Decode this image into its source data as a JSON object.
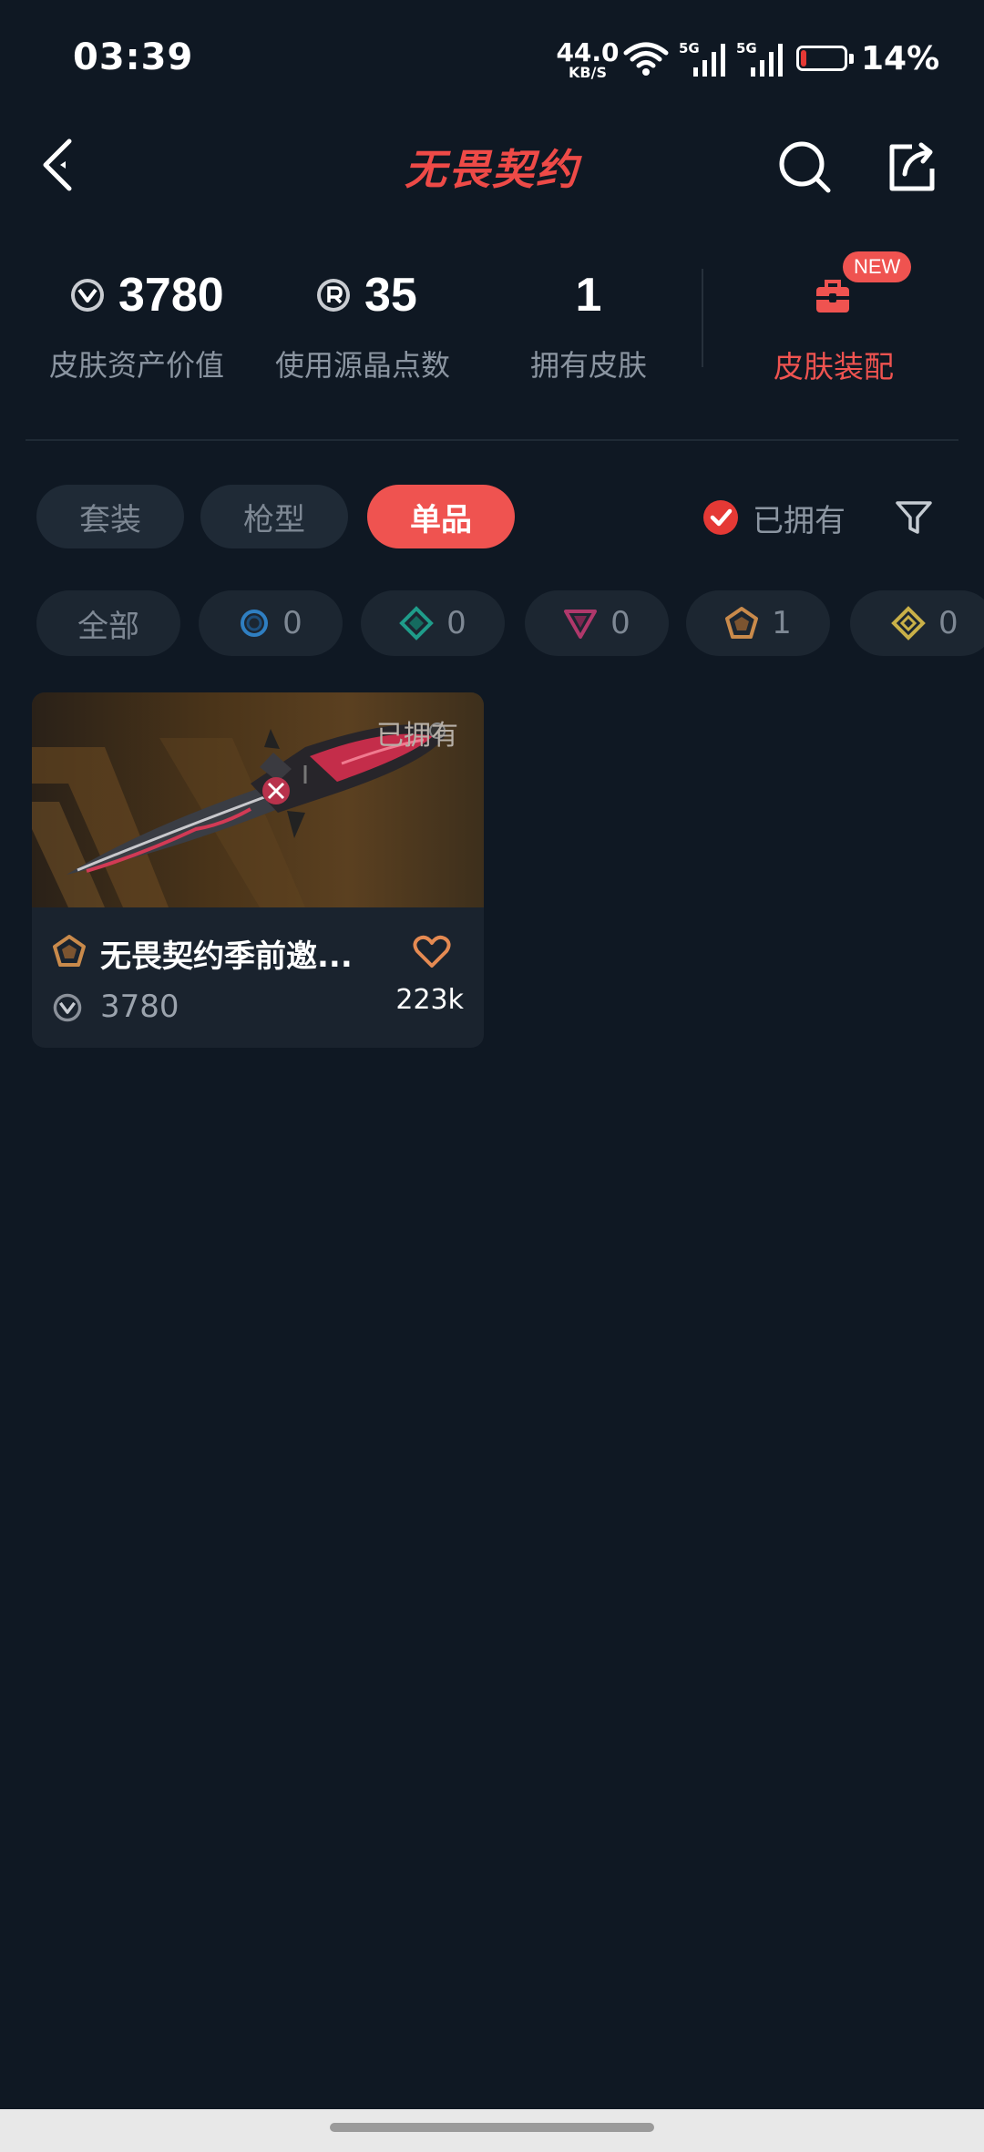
{
  "status_bar": {
    "time": "03:39",
    "net_speed_value": "44.0",
    "net_speed_unit": "KB/S",
    "signal1_label": "5G",
    "signal2_label": "5G",
    "battery_percent": "14%",
    "battery_level": 0.14,
    "battery_color": "#e53935"
  },
  "header": {
    "title": "无畏契约",
    "back_icon": "back-arrow-icon",
    "search_icon": "search-icon",
    "share_icon": "share-icon"
  },
  "stats": {
    "asset_value": "3780",
    "asset_value_label": "皮肤资产价值",
    "radianite_points": "35",
    "radianite_points_label": "使用源晶点数",
    "owned_skins": "1",
    "owned_skins_label": "拥有皮肤",
    "loadout_label": "皮肤装配",
    "new_badge": "NEW"
  },
  "tabs": [
    {
      "label": "套装",
      "active": false
    },
    {
      "label": "枪型",
      "active": false
    },
    {
      "label": "单品",
      "active": true
    }
  ],
  "filters": {
    "owned_label": "已拥有",
    "owned_checked": true,
    "filter_icon": "filter-icon"
  },
  "rarity_chips": [
    {
      "label": "全部"
    },
    {
      "icon": "select-tier-icon",
      "count": "0",
      "color": "#2f7fc2"
    },
    {
      "icon": "deluxe-tier-icon",
      "count": "0",
      "color": "#1f9c8a"
    },
    {
      "icon": "premium-tier-icon",
      "count": "0",
      "color": "#b0386b"
    },
    {
      "icon": "exclusive-tier-icon",
      "count": "1",
      "color": "#c98a4b"
    },
    {
      "icon": "ultra-tier-icon",
      "count": "0",
      "color": "#c9b048"
    }
  ],
  "skins": [
    {
      "owned_tag": "已拥有",
      "name": "无畏契约季前邀...",
      "price": "3780",
      "likes": "223k",
      "tier_icon": "exclusive-tier-icon"
    }
  ],
  "colors": {
    "accent": "#ef5350",
    "background": "#0f1823"
  }
}
